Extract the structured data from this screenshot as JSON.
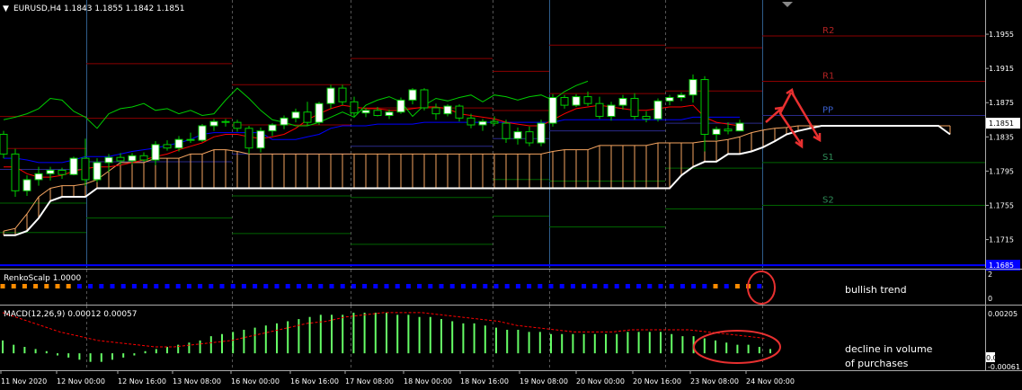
{
  "window": {
    "symbol_line": "EURUSD,H4  1.1843 1.1855 1.1842 1.1851",
    "menu_glyph": "▼"
  },
  "colors": {
    "background": "#000000",
    "grid": "#3a3a3a",
    "bull_candle": "#ffffff",
    "bear_candle": "#000000",
    "candle_outline": "#00cc00",
    "senkou_a": "#ffffff",
    "cloud_fill": "#f4a460",
    "kijun": "#0000ff",
    "tenkan": "#ff0000",
    "chikou": "#00cc00",
    "pivot_line": "#8b0000",
    "support_line": "#006400",
    "macd_hist": "#66ff66",
    "macd_signal": "#ff0000",
    "renko_up": "#0000ff",
    "renko_down": "#ff8c00",
    "annotation": "#e83030",
    "price_badge": "#ffffff",
    "blue_line_badge": "#0000ff"
  },
  "chart_data": {
    "type": "candlestick",
    "symbol": "EURUSD",
    "timeframe": "H4",
    "ohlc_header": {
      "open": 1.1843,
      "high": 1.1855,
      "low": 1.1842,
      "close": 1.1851
    },
    "price_axis_ticks": [
      "1.1955",
      "1.1915",
      "1.1875",
      "1.1835",
      "1.1795",
      "1.1755",
      "1.1715"
    ],
    "ylim": [
      1.1682,
      1.1995
    ],
    "current_price_label": "1.1851",
    "blue_line_label": "1.1685",
    "blue_line_value": 1.1685,
    "pivots": [
      {
        "name": "R2",
        "value": 1.1953
      },
      {
        "name": "R1",
        "value": 1.19
      },
      {
        "name": "PP",
        "value": 1.186
      },
      {
        "name": "S1",
        "value": 1.1805
      },
      {
        "name": "S2",
        "value": 1.1755
      }
    ],
    "time_labels": [
      "11 Nov 2020",
      "12 Nov 00:00",
      "12 Nov 16:00",
      "13 Nov 08:00",
      "16 Nov 00:00",
      "16 Nov 16:00",
      "17 Nov 08:00",
      "18 Nov 00:00",
      "18 Nov 16:00",
      "19 Nov 08:00",
      "20 Nov 00:00",
      "20 Nov 16:00",
      "23 Nov 08:00",
      "24 Nov 00:00"
    ],
    "candles": [
      [
        1.1838,
        1.1842,
        1.181,
        1.1815
      ],
      [
        1.1815,
        1.1821,
        1.1765,
        1.1772
      ],
      [
        1.1772,
        1.179,
        1.1766,
        1.1785
      ],
      [
        1.1785,
        1.18,
        1.1778,
        1.1792
      ],
      [
        1.1792,
        1.18,
        1.1784,
        1.1796
      ],
      [
        1.1796,
        1.1799,
        1.1786,
        1.1791
      ],
      [
        1.1791,
        1.1812,
        1.179,
        1.181
      ],
      [
        1.181,
        1.1833,
        1.1778,
        1.1785
      ],
      [
        1.1785,
        1.181,
        1.1782,
        1.1805
      ],
      [
        1.1805,
        1.1815,
        1.1794,
        1.1811
      ],
      [
        1.1811,
        1.1816,
        1.1802,
        1.1807
      ],
      [
        1.1807,
        1.1816,
        1.1803,
        1.1813
      ],
      [
        1.1813,
        1.1817,
        1.1806,
        1.1808
      ],
      [
        1.1808,
        1.183,
        1.1802,
        1.1826
      ],
      [
        1.1826,
        1.1831,
        1.1819,
        1.1822
      ],
      [
        1.1822,
        1.1836,
        1.1818,
        1.1832
      ],
      [
        1.1832,
        1.184,
        1.1828,
        1.1831
      ],
      [
        1.1831,
        1.185,
        1.1829,
        1.1848
      ],
      [
        1.1848,
        1.1856,
        1.1842,
        1.1853
      ],
      [
        1.1853,
        1.1856,
        1.1847,
        1.1852
      ],
      [
        1.1852,
        1.1855,
        1.1841,
        1.1845
      ],
      [
        1.1845,
        1.1848,
        1.1815,
        1.1822
      ],
      [
        1.1822,
        1.1846,
        1.1817,
        1.1842
      ],
      [
        1.1842,
        1.1851,
        1.1836,
        1.1849
      ],
      [
        1.1849,
        1.186,
        1.1844,
        1.1857
      ],
      [
        1.1857,
        1.1868,
        1.1852,
        1.1864
      ],
      [
        1.1864,
        1.1876,
        1.1848,
        1.1852
      ],
      [
        1.1852,
        1.1876,
        1.1849,
        1.1874
      ],
      [
        1.1874,
        1.1896,
        1.1868,
        1.1892
      ],
      [
        1.1892,
        1.1896,
        1.1872,
        1.1876
      ],
      [
        1.1876,
        1.1882,
        1.1858,
        1.1863
      ],
      [
        1.1863,
        1.1869,
        1.1858,
        1.1866
      ],
      [
        1.1866,
        1.187,
        1.1859,
        1.186
      ],
      [
        1.186,
        1.1867,
        1.1856,
        1.1864
      ],
      [
        1.1864,
        1.1881,
        1.1862,
        1.1878
      ],
      [
        1.1878,
        1.1892,
        1.1873,
        1.189
      ],
      [
        1.189,
        1.1892,
        1.1866,
        1.1869
      ],
      [
        1.1869,
        1.1874,
        1.1855,
        1.1862
      ],
      [
        1.1862,
        1.1873,
        1.1859,
        1.1871
      ],
      [
        1.1871,
        1.1873,
        1.1853,
        1.1857
      ],
      [
        1.1857,
        1.1862,
        1.1845,
        1.1849
      ],
      [
        1.1849,
        1.1856,
        1.1842,
        1.1853
      ],
      [
        1.1853,
        1.1859,
        1.1848,
        1.1851
      ],
      [
        1.1851,
        1.1855,
        1.1828,
        1.1833
      ],
      [
        1.1833,
        1.1846,
        1.1826,
        1.1841
      ],
      [
        1.1841,
        1.1847,
        1.1824,
        1.1828
      ],
      [
        1.1828,
        1.1855,
        1.1824,
        1.1851
      ],
      [
        1.1851,
        1.1885,
        1.1847,
        1.1881
      ],
      [
        1.1881,
        1.1884,
        1.1868,
        1.1872
      ],
      [
        1.1872,
        1.1885,
        1.187,
        1.1882
      ],
      [
        1.1882,
        1.1888,
        1.1871,
        1.1874
      ],
      [
        1.1874,
        1.1882,
        1.1856,
        1.1859
      ],
      [
        1.1859,
        1.1876,
        1.1854,
        1.1872
      ],
      [
        1.1872,
        1.1884,
        1.1867,
        1.188
      ],
      [
        1.188,
        1.1886,
        1.1855,
        1.1859
      ],
      [
        1.1859,
        1.1865,
        1.1852,
        1.1856
      ],
      [
        1.1856,
        1.188,
        1.1853,
        1.1877
      ],
      [
        1.1877,
        1.1884,
        1.1872,
        1.1881
      ],
      [
        1.1881,
        1.1887,
        1.1877,
        1.1884
      ],
      [
        1.1884,
        1.1908,
        1.1875,
        1.1902
      ],
      [
        1.1902,
        1.1906,
        1.1818,
        1.1838
      ],
      [
        1.1838,
        1.1847,
        1.1831,
        1.1844
      ],
      [
        1.1844,
        1.1852,
        1.1838,
        1.1842
      ],
      [
        1.1842,
        1.1855,
        1.1842,
        1.1851
      ]
    ],
    "senkou_a": [
      1.172,
      1.172,
      1.1725,
      1.174,
      1.176,
      1.1765,
      1.1765,
      1.1765,
      1.1775,
      1.1775,
      1.1775,
      1.1775,
      1.1775,
      1.1775,
      1.1775,
      1.1775,
      1.1775,
      1.1775,
      1.1775,
      1.1775,
      1.1775,
      1.1775,
      1.1775,
      1.1775,
      1.1775,
      1.1775,
      1.1775,
      1.1775,
      1.1775,
      1.1775,
      1.1775,
      1.1775,
      1.1775,
      1.1775,
      1.1775,
      1.1775,
      1.1775,
      1.1775,
      1.1775,
      1.1775,
      1.1775,
      1.1775,
      1.1775,
      1.1775,
      1.1775,
      1.1775,
      1.1775,
      1.1775,
      1.1775,
      1.1775,
      1.1775,
      1.1775,
      1.1775,
      1.1775,
      1.1775,
      1.1775,
      1.1775,
      1.1775,
      1.179,
      1.18,
      1.1806,
      1.1806,
      1.1815,
      1.1815,
      1.1818,
      1.1823,
      1.183,
      1.1838,
      1.1842,
      1.1845,
      1.1848,
      1.1848,
      1.1848,
      1.1848,
      1.1848,
      1.1848,
      1.1848,
      1.1848,
      1.1848,
      1.1848,
      1.1848,
      1.1838
    ],
    "senkou_b": [
      1.1725,
      1.1728,
      1.1745,
      1.1765,
      1.1775,
      1.1778,
      1.1778,
      1.178,
      1.1785,
      1.1795,
      1.1805,
      1.1805,
      1.1805,
      1.181,
      1.181,
      1.181,
      1.1815,
      1.1815,
      1.182,
      1.182,
      1.1818,
      1.1815,
      1.1815,
      1.1815,
      1.1815,
      1.1815,
      1.1815,
      1.1815,
      1.1815,
      1.1815,
      1.1815,
      1.1815,
      1.1815,
      1.1815,
      1.1815,
      1.1815,
      1.1815,
      1.1815,
      1.1815,
      1.1815,
      1.1815,
      1.1815,
      1.1815,
      1.1815,
      1.1815,
      1.1815,
      1.1815,
      1.1818,
      1.182,
      1.182,
      1.182,
      1.1825,
      1.1825,
      1.1825,
      1.1825,
      1.1825,
      1.1828,
      1.1828,
      1.1828,
      1.1828,
      1.183,
      1.183,
      1.1832,
      1.1835,
      1.184,
      1.1843,
      1.1845,
      1.1846,
      1.1848,
      1.1848,
      1.1848,
      1.1848,
      1.1848,
      1.1848,
      1.1848,
      1.1848,
      1.1848,
      1.1848,
      1.1848,
      1.1848,
      1.1848,
      1.1848
    ],
    "kijun": [
      1.181,
      1.181,
      1.1808,
      1.1805,
      1.1805,
      1.1805,
      1.1808,
      1.1812,
      1.1812,
      1.1812,
      1.1815,
      1.1818,
      1.182,
      1.1822,
      1.1825,
      1.1828,
      1.1832,
      1.1838,
      1.184,
      1.184,
      1.184,
      1.184,
      1.184,
      1.1832,
      1.1832,
      1.1832,
      1.1835,
      1.1838,
      1.1845,
      1.1848,
      1.1848,
      1.1848,
      1.185,
      1.185,
      1.185,
      1.185,
      1.1852,
      1.1852,
      1.1852,
      1.1852,
      1.1852,
      1.1852,
      1.1852,
      1.1852,
      1.1852,
      1.1852,
      1.1852,
      1.1852,
      1.1855,
      1.1855,
      1.1855,
      1.1855,
      1.1855,
      1.1855,
      1.1855,
      1.1855,
      1.1855,
      1.1855,
      1.1855,
      1.1858,
      1.1858,
      1.1858,
      1.1858,
      1.1858
    ],
    "tenkan": [
      1.18,
      1.18,
      1.1792,
      1.1788,
      1.1788,
      1.179,
      1.1795,
      1.1798,
      1.18,
      1.18,
      1.1802,
      1.1805,
      1.1808,
      1.1812,
      1.1815,
      1.182,
      1.1824,
      1.1828,
      1.1835,
      1.1838,
      1.1838,
      1.1835,
      1.1833,
      1.1835,
      1.1838,
      1.1845,
      1.1855,
      1.1862,
      1.1868,
      1.1872,
      1.187,
      1.1868,
      1.1868,
      1.1866,
      1.1866,
      1.1868,
      1.187,
      1.187,
      1.1868,
      1.1862,
      1.186,
      1.1858,
      1.1856,
      1.1852,
      1.185,
      1.1848,
      1.1848,
      1.1855,
      1.1862,
      1.1868,
      1.187,
      1.1872,
      1.187,
      1.1868,
      1.1866,
      1.1866,
      1.1868,
      1.187,
      1.187,
      1.1872,
      1.1858,
      1.1852,
      1.185,
      1.1848
    ],
    "chikou": [
      1.1855,
      1.1858,
      1.1862,
      1.1868,
      1.188,
      1.1878,
      1.1865,
      1.1858,
      1.1845,
      1.1862,
      1.1868,
      1.187,
      1.1874,
      1.1866,
      1.1868,
      1.1862,
      1.1866,
      1.186,
      1.1862,
      1.1878,
      1.1892,
      1.188,
      1.1866,
      1.1855,
      1.1852,
      1.1848,
      1.1848,
      1.1852,
      1.1858,
      1.1864,
      1.1858,
      1.1872,
      1.1878,
      1.1882,
      1.1876,
      1.1859,
      1.1872,
      1.188,
      1.1877,
      1.1881,
      1.1884,
      1.1876,
      1.1884,
      1.1882,
      1.1878,
      1.1882,
      1.1884,
      1.1878,
      1.1888,
      1.1895,
      1.19
    ],
    "renko": {
      "label": "RenkoScalp 1.0000",
      "axis_ticks": [
        "2",
        "0"
      ],
      "annotation": "bullish trend",
      "states": [
        "d",
        "d",
        "d",
        "d",
        "d",
        "d",
        "d",
        "u",
        "u",
        "u",
        "u",
        "u",
        "u",
        "u",
        "u",
        "u",
        "u",
        "u",
        "u",
        "u",
        "u",
        "u",
        "u",
        "u",
        "u",
        "u",
        "u",
        "u",
        "u",
        "u",
        "u",
        "u",
        "u",
        "u",
        "u",
        "u",
        "u",
        "u",
        "u",
        "u",
        "u",
        "u",
        "u",
        "u",
        "u",
        "u",
        "u",
        "u",
        "u",
        "u",
        "u",
        "u",
        "u",
        "u",
        "u",
        "u",
        "u",
        "u",
        "u",
        "u",
        "u",
        "u",
        "u",
        "u",
        "u",
        "d",
        "u",
        "d",
        "d",
        "u"
      ]
    },
    "macd": {
      "label": "MACD(12,26,9) 0.00012 0.00057",
      "axis_ticks": [
        "0.00205",
        "0.00",
        "-0.00061"
      ],
      "ylim": [
        -0.00075,
        0.00215
      ],
      "annotation_line1": "decline in volume",
      "annotation_line2": "of purchases",
      "histogram": [
        0.0006,
        0.0004,
        0.0003,
        0.0002,
        0.0001,
        -0.0001,
        -0.0002,
        -0.0003,
        -0.0004,
        -0.0004,
        -0.0003,
        -0.0002,
        -0.0001,
        0.0001,
        0.0002,
        0.0003,
        0.0004,
        0.0005,
        0.0006,
        0.0008,
        0.0009,
        0.001,
        0.0011,
        0.0012,
        0.0013,
        0.0014,
        0.0015,
        0.0016,
        0.0017,
        0.0018,
        0.0018,
        0.0018,
        0.0019,
        0.0019,
        0.0019,
        0.0019,
        0.0018,
        0.0018,
        0.0017,
        0.0017,
        0.0016,
        0.0015,
        0.0014,
        0.0014,
        0.0013,
        0.0012,
        0.0011,
        0.0011,
        0.001,
        0.001,
        0.0009,
        0.0009,
        0.0009,
        0.0009,
        0.0009,
        0.0009,
        0.0009,
        0.001,
        0.001,
        0.001,
        0.001,
        0.0009,
        0.0008,
        0.0008,
        0.0007,
        0.0006,
        0.0005,
        0.0004,
        0.0004,
        0.0003,
        0.0002
      ],
      "signal": [
        0.0019,
        0.0016,
        0.0013,
        0.001,
        0.0008,
        0.0006,
        0.0005,
        0.0004,
        0.0003,
        0.0003,
        0.0004,
        0.0005,
        0.0006,
        0.0008,
        0.001,
        0.0012,
        0.0014,
        0.0015,
        0.0017,
        0.0018,
        0.0019,
        0.0019,
        0.0019,
        0.0018,
        0.0017,
        0.0016,
        0.0015,
        0.0013,
        0.0012,
        0.0011,
        0.001,
        0.001,
        0.001,
        0.0011,
        0.0011,
        0.0011,
        0.0011,
        0.001,
        0.0009,
        0.0008,
        0.0007
      ]
    }
  }
}
